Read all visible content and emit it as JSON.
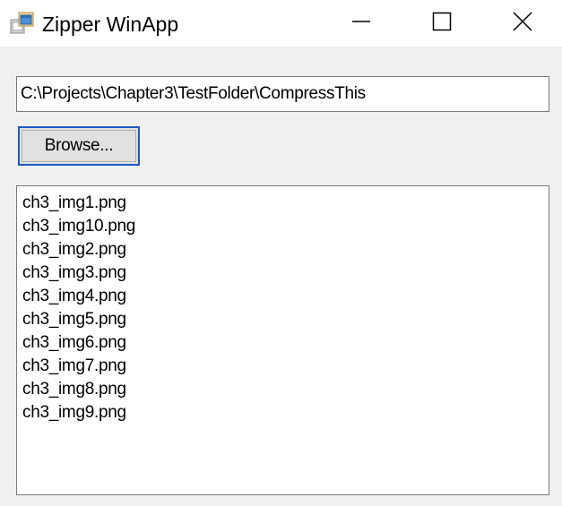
{
  "window": {
    "title": "Zipper WinApp",
    "icon": "winforms-app-icon",
    "controls": {
      "minimize_icon": "minimize-icon",
      "maximize_icon": "maximize-icon",
      "close_icon": "close-icon"
    }
  },
  "form": {
    "path_value": "C:\\Projects\\Chapter3\\TestFolder\\CompressThis",
    "browse_label": "Browse...",
    "files": [
      "ch3_img1.png",
      "ch3_img10.png",
      "ch3_img2.png",
      "ch3_img3.png",
      "ch3_img4.png",
      "ch3_img5.png",
      "ch3_img6.png",
      "ch3_img7.png",
      "ch3_img8.png",
      "ch3_img9.png"
    ]
  },
  "colors": {
    "window_bg": "#eff0ef",
    "focus_border": "#1e57c6",
    "button_face": "#e1e1e1"
  }
}
